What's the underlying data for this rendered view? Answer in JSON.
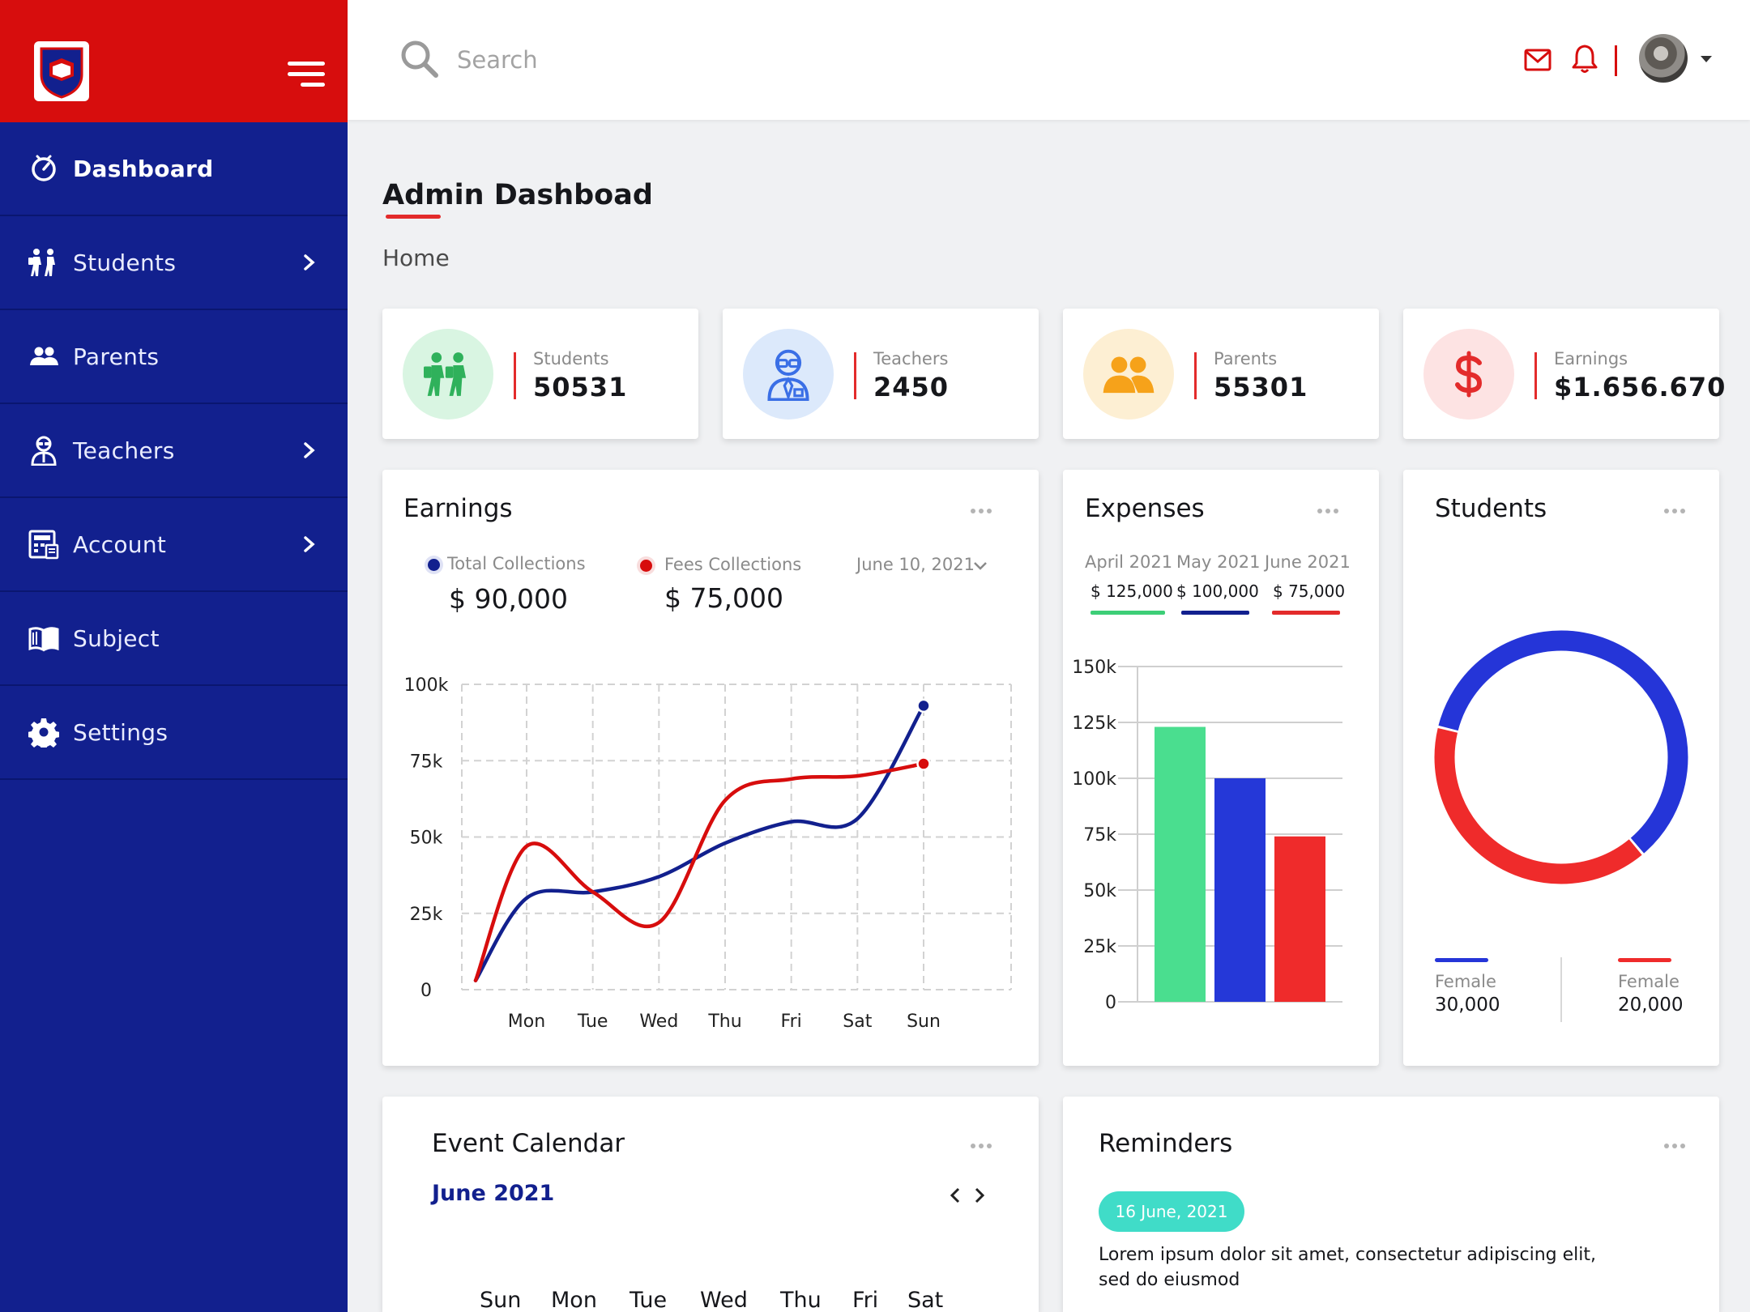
{
  "sidebar": {
    "items": [
      {
        "label": "Dashboard",
        "icon": "dashboard-icon"
      },
      {
        "label": "Students",
        "icon": "students-icon"
      },
      {
        "label": "Parents",
        "icon": "parents-icon"
      },
      {
        "label": "Teachers",
        "icon": "teachers-icon"
      },
      {
        "label": "Account",
        "icon": "account-icon"
      },
      {
        "label": "Subject",
        "icon": "subject-icon"
      },
      {
        "label": "Settings",
        "icon": "gear-icon"
      }
    ]
  },
  "topbar": {
    "search_placeholder": "Search"
  },
  "page": {
    "title": "Admin Dashboad",
    "breadcrumb": "Home"
  },
  "stats": [
    {
      "label": "Students",
      "value": "50531",
      "color": "#2fb15b",
      "bg": "#d9f5e2",
      "icon": "students-icon"
    },
    {
      "label": "Teachers",
      "value": "2450",
      "color": "#3a6fe6",
      "bg": "#dce9fb",
      "icon": "teacher-icon"
    },
    {
      "label": "Parents",
      "value": "55301",
      "color": "#f6a21a",
      "bg": "#fdefd3",
      "icon": "parents-icon"
    },
    {
      "label": "Earnings",
      "value": "$1.656.670",
      "color": "#e32b2b",
      "bg": "#fde3e3",
      "icon": "dollar-icon"
    }
  ],
  "earnings": {
    "title": "Earnings",
    "legend": [
      {
        "label": "Total Collections",
        "value": "$ 90,000",
        "color": "#12208e"
      },
      {
        "label": "Fees Collections",
        "value": "$ 75,000",
        "color": "#d70d0d"
      }
    ],
    "date": "June 10, 2021"
  },
  "expenses": {
    "title": "Expenses",
    "months": [
      {
        "label": "April 2021",
        "value": "$ 125,000",
        "color": "#3dce77"
      },
      {
        "label": "May 2021",
        "value": "$ 100,000",
        "color": "#12208e"
      },
      {
        "label": "June 2021",
        "value": "$ 75,000",
        "color": "#e32b2b"
      }
    ]
  },
  "students_card": {
    "title": "Students",
    "legend": [
      {
        "label": "Female",
        "value": "30,000",
        "color": "#2535d8"
      },
      {
        "label": "Female",
        "value": "20,000",
        "color": "#ef2b2b"
      }
    ]
  },
  "calendar": {
    "title": "Event Calendar",
    "month": "June 2021",
    "days": [
      "Sun",
      "Mon",
      "Tue",
      "Wed",
      "Thu",
      "Fri",
      "Sat"
    ]
  },
  "reminders": {
    "title": "Reminders",
    "date": "16 June, 2021",
    "text": "Lorem ipsum dolor sit amet, consectetur adipiscing elit, sed do eiusmod"
  },
  "chart_data": [
    {
      "type": "line",
      "categories": [
        "Mon",
        "Tue",
        "Wed",
        "Thu",
        "Fri",
        "Sat",
        "Sun"
      ],
      "yticks": [
        "0",
        "25k",
        "50k",
        "75k",
        "100k"
      ],
      "ylim": [
        0,
        100000
      ],
      "grid": true,
      "series": [
        {
          "name": "Total Collections",
          "color": "#12208e",
          "values": [
            30000,
            32000,
            37000,
            48000,
            55000,
            56000,
            93000
          ]
        },
        {
          "name": "Fees Collections",
          "color": "#d70d0d",
          "values": [
            47000,
            32000,
            22000,
            62000,
            69000,
            70000,
            74000
          ]
        }
      ]
    },
    {
      "type": "bar",
      "categories": [
        "April 2021",
        "May 2021",
        "June 2021"
      ],
      "values": [
        123000,
        100000,
        74000
      ],
      "colors": [
        "#4ade8f",
        "#2538d8",
        "#ef2b2b"
      ],
      "yticks": [
        "0",
        "25k",
        "50k",
        "75k",
        "100k",
        "125k",
        "150k"
      ],
      "ylim": [
        0,
        150000
      ],
      "grid": true
    },
    {
      "type": "pie",
      "values": [
        30000,
        20000
      ],
      "colors": [
        "#2535d8",
        "#ef2b2b"
      ]
    }
  ]
}
